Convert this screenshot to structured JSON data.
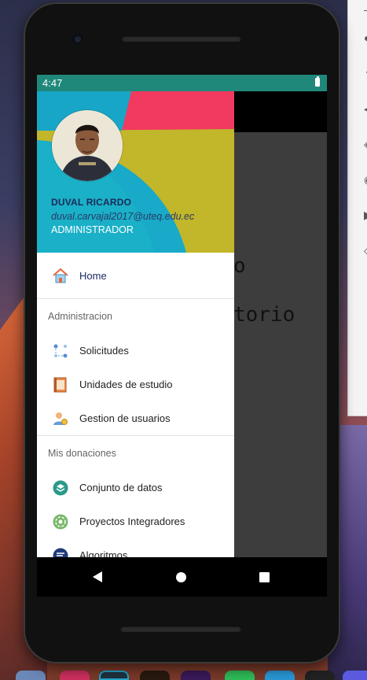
{
  "status_bar": {
    "time": "4:47"
  },
  "background_app": {
    "text_lines": [
      "o",
      "torio"
    ]
  },
  "drawer": {
    "header": {
      "name": "DUVAL RICARDO",
      "email": "duval.carvajal2017@uteq.edu.ec",
      "role": "ADMINISTRADOR"
    },
    "home": {
      "label": "Home",
      "icon": "home-icon"
    },
    "sections": [
      {
        "title": "Administracion",
        "items": [
          {
            "label": "Solicitudes",
            "icon": "requests-icon"
          },
          {
            "label": "Unidades de estudio",
            "icon": "book-icon"
          },
          {
            "label": "Gestion de usuarios",
            "icon": "user-manage-icon"
          }
        ]
      },
      {
        "title": "Mis donaciones",
        "items": [
          {
            "label": "Conjunto de datos",
            "icon": "dataset-icon"
          },
          {
            "label": "Proyectos Integradores",
            "icon": "projects-icon"
          },
          {
            "label": "Algoritmos",
            "icon": "algorithm-icon"
          }
        ]
      }
    ]
  },
  "navigation": {
    "back": "back",
    "home": "home",
    "recents": "recents"
  }
}
